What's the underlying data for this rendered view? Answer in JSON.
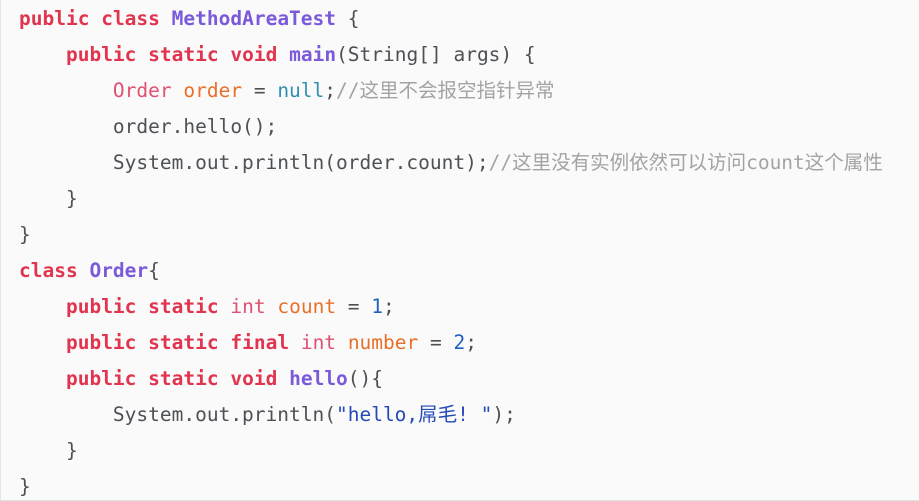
{
  "editor": {
    "language": "Java",
    "background_color": "#fafafa",
    "font_size_px": 19.5,
    "line_height_px": 36,
    "indent_unit": "    ",
    "palette": {
      "keyword": "#e0344f",
      "declaration_name": "#7b5ad9",
      "type_reference": "#e05070",
      "variable": "#e8702a",
      "null_literal": "#2e8fb0",
      "number_literal": "#2060c0",
      "string_literal": "#2449b5",
      "comment": "#a3a3a3",
      "plain_text": "#4d5156"
    }
  },
  "code": {
    "lines": [
      {
        "indent": "",
        "tokens": [
          {
            "text": "public",
            "kind": "keyword"
          },
          {
            "text": " ",
            "kind": "plain"
          },
          {
            "text": "class",
            "kind": "keyword"
          },
          {
            "text": " ",
            "kind": "plain"
          },
          {
            "text": "MethodAreaTest",
            "kind": "declaration_name"
          },
          {
            "text": " {",
            "kind": "plain"
          }
        ]
      },
      {
        "indent": "    ",
        "tokens": [
          {
            "text": "public",
            "kind": "keyword"
          },
          {
            "text": " ",
            "kind": "plain"
          },
          {
            "text": "static",
            "kind": "keyword"
          },
          {
            "text": " ",
            "kind": "plain"
          },
          {
            "text": "void",
            "kind": "keyword"
          },
          {
            "text": " ",
            "kind": "plain"
          },
          {
            "text": "main",
            "kind": "declaration_name"
          },
          {
            "text": "(String[] args) {",
            "kind": "plain"
          }
        ]
      },
      {
        "indent": "        ",
        "tokens": [
          {
            "text": "Order",
            "kind": "type_reference"
          },
          {
            "text": " ",
            "kind": "plain"
          },
          {
            "text": "order",
            "kind": "variable"
          },
          {
            "text": " = ",
            "kind": "plain"
          },
          {
            "text": "null",
            "kind": "null_literal"
          },
          {
            "text": ";",
            "kind": "plain"
          },
          {
            "text": "//这里不会报空指针异常",
            "kind": "comment"
          }
        ]
      },
      {
        "indent": "        ",
        "tokens": [
          {
            "text": "order.hello();",
            "kind": "plain"
          }
        ]
      },
      {
        "indent": "        ",
        "tokens": [
          {
            "text": "System.out.println(order.count);",
            "kind": "plain"
          },
          {
            "text": "//这里没有实例依然可以访问count这个属性",
            "kind": "comment"
          }
        ]
      },
      {
        "indent": "    ",
        "tokens": [
          {
            "text": "}",
            "kind": "plain"
          }
        ]
      },
      {
        "indent": "",
        "tokens": [
          {
            "text": "}",
            "kind": "plain"
          }
        ]
      },
      {
        "indent": "",
        "tokens": [
          {
            "text": "class",
            "kind": "keyword"
          },
          {
            "text": " ",
            "kind": "plain"
          },
          {
            "text": "Order",
            "kind": "declaration_name"
          },
          {
            "text": "{",
            "kind": "plain"
          }
        ]
      },
      {
        "indent": "    ",
        "tokens": [
          {
            "text": "public",
            "kind": "keyword"
          },
          {
            "text": " ",
            "kind": "plain"
          },
          {
            "text": "static",
            "kind": "keyword"
          },
          {
            "text": " ",
            "kind": "plain"
          },
          {
            "text": "int",
            "kind": "type_reference"
          },
          {
            "text": " ",
            "kind": "plain"
          },
          {
            "text": "count",
            "kind": "variable"
          },
          {
            "text": " = ",
            "kind": "plain"
          },
          {
            "text": "1",
            "kind": "number_literal"
          },
          {
            "text": ";",
            "kind": "plain"
          }
        ]
      },
      {
        "indent": "    ",
        "tokens": [
          {
            "text": "public",
            "kind": "keyword"
          },
          {
            "text": " ",
            "kind": "plain"
          },
          {
            "text": "static",
            "kind": "keyword"
          },
          {
            "text": " ",
            "kind": "plain"
          },
          {
            "text": "final",
            "kind": "keyword"
          },
          {
            "text": " ",
            "kind": "plain"
          },
          {
            "text": "int",
            "kind": "type_reference"
          },
          {
            "text": " ",
            "kind": "plain"
          },
          {
            "text": "number",
            "kind": "variable"
          },
          {
            "text": " = ",
            "kind": "plain"
          },
          {
            "text": "2",
            "kind": "number_literal"
          },
          {
            "text": ";",
            "kind": "plain"
          }
        ]
      },
      {
        "indent": "    ",
        "tokens": [
          {
            "text": "public",
            "kind": "keyword"
          },
          {
            "text": " ",
            "kind": "plain"
          },
          {
            "text": "static",
            "kind": "keyword"
          },
          {
            "text": " ",
            "kind": "plain"
          },
          {
            "text": "void",
            "kind": "keyword"
          },
          {
            "text": " ",
            "kind": "plain"
          },
          {
            "text": "hello",
            "kind": "declaration_name"
          },
          {
            "text": "(){",
            "kind": "plain"
          }
        ]
      },
      {
        "indent": "        ",
        "tokens": [
          {
            "text": "System.out.println(",
            "kind": "plain"
          },
          {
            "text": "\"hello,屌毛! \"",
            "kind": "string_literal"
          },
          {
            "text": ");",
            "kind": "plain"
          }
        ]
      },
      {
        "indent": "    ",
        "tokens": [
          {
            "text": "}",
            "kind": "plain"
          }
        ]
      },
      {
        "indent": "",
        "tokens": [
          {
            "text": "}",
            "kind": "plain"
          }
        ]
      }
    ]
  }
}
